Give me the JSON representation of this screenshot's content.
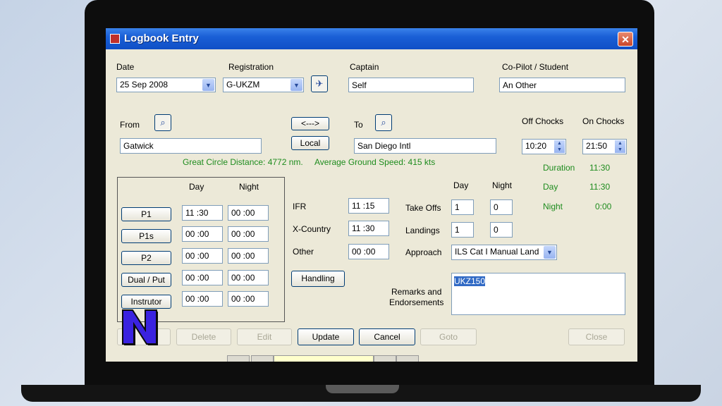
{
  "window": {
    "title": "Logbook Entry",
    "close": "✕"
  },
  "labels": {
    "date": "Date",
    "registration": "Registration",
    "captain": "Captain",
    "copilot": "Co-Pilot / Student",
    "from": "From",
    "to": "To",
    "off_chocks": "Off Chocks",
    "on_chocks": "On Chocks",
    "day": "Day",
    "night": "Night",
    "ifr": "IFR",
    "xcountry": "X-Country",
    "other": "Other",
    "takeoffs": "Take Offs",
    "landings": "Landings",
    "approach": "Approach",
    "remarks": "Remarks and\nEndorsements"
  },
  "fields": {
    "date": "25 Sep 2008",
    "registration": "G-UKZM",
    "captain": "Self",
    "copilot": "An Other",
    "from": "Gatwick",
    "to": "San Diego Intl",
    "off_chocks": "10:20",
    "on_chocks": "21:50",
    "ifr": "11 :15",
    "xcountry": "11 :30",
    "other": "00 :00",
    "takeoffs_day": "1",
    "takeoffs_night": "0",
    "landings_day": "1",
    "landings_night": "0",
    "approach": "ILS Cat I Manual Land",
    "remarks": "UKZ150"
  },
  "buttons": {
    "swap": "<--->",
    "local": "Local",
    "handling": "Handling",
    "delete": "Delete",
    "edit": "Edit",
    "update": "Update",
    "cancel": "Cancel",
    "goto": "Goto",
    "close": "Close"
  },
  "stats": {
    "distance": "Great Circle Distance: 4772 nm.",
    "speed": "Average Ground Speed: 415 kts",
    "duration_label": "Duration",
    "duration_value": "11:30",
    "day_label": "Day",
    "day_value": "11:30",
    "night_label": "Night",
    "night_value": "0:00"
  },
  "roles": [
    {
      "label": "P1",
      "day": "11 :30",
      "night": "00 :00"
    },
    {
      "label": "P1s",
      "day": "00 :00",
      "night": "00 :00"
    },
    {
      "label": "P2",
      "day": "00 :00",
      "night": "00 :00"
    },
    {
      "label": "Dual / Put",
      "day": "00 :00",
      "night": "00 :00"
    },
    {
      "label": "Instrutor",
      "day": "00 :00",
      "night": "00 :00"
    }
  ],
  "icons": {
    "aircraft": "aircraft-icon",
    "airport": "airport-search-icon",
    "logo": "n-logo"
  },
  "colors": {
    "titlebar": "#0f4fc6",
    "stats_green": "#1e8c1e",
    "form_bg": "#ece9d8"
  }
}
